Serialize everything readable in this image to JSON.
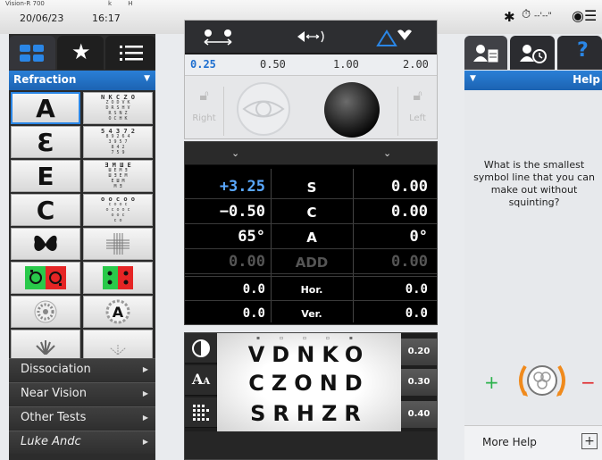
{
  "status_bar": {
    "device_name": "Vision-R 700",
    "ab_marks": "k H",
    "date": "20/06/23",
    "time": "16:17",
    "timer_text": "--'--\"",
    "settings_icon": "gear-icon",
    "timer_icon": "stopwatch-icon",
    "binocular_icon": "eyes-icon"
  },
  "left_panel": {
    "tabs": [
      {
        "icon": "grid-icon",
        "active": true
      },
      {
        "icon": "star-icon",
        "active": false
      },
      {
        "icon": "list-icon",
        "active": false
      }
    ],
    "section_title": "Refraction",
    "tests": [
      {
        "type": "letter",
        "text": "A"
      },
      {
        "type": "chart",
        "lines": [
          "N K C Z O",
          "Z O D V K",
          "D R S H V",
          "R S N Z",
          "O C H K"
        ]
      },
      {
        "type": "letter",
        "text": "Ɛ"
      },
      {
        "type": "chart",
        "lines": [
          "5 4 3 7 2",
          "8 9 2 6 4",
          "3 9 5 7",
          "8 4 2",
          "7 5 9"
        ]
      },
      {
        "type": "letter",
        "text": "E"
      },
      {
        "type": "chart",
        "lines": [
          "Ǝ M Ш E",
          "Ш E M Ǝ",
          "Ш Ǝ E M",
          "E Ш M",
          "M Ǝ"
        ]
      },
      {
        "type": "letter",
        "text": "C"
      },
      {
        "type": "chart",
        "lines": [
          "o o c o o",
          "c o o c",
          "o c o o c",
          "o o c",
          "c o"
        ]
      },
      {
        "type": "icon",
        "text": "butterfly"
      },
      {
        "type": "icon",
        "text": "cross-grid"
      },
      {
        "type": "icon",
        "text": "red-green-duochrome"
      },
      {
        "type": "icon",
        "text": "red-green-dots"
      },
      {
        "type": "icon",
        "text": "astigmatic-dial"
      },
      {
        "type": "icon",
        "text": "circled-A"
      }
    ],
    "menu": [
      {
        "label": "Dissociation"
      },
      {
        "label": "Near Vision"
      },
      {
        "label": "Other Tests"
      },
      {
        "label": "Luke Andc"
      }
    ],
    "colors": {
      "accent": "#1f6fd0"
    }
  },
  "phoropter": {
    "toolbar_icons": [
      "eye-distance-icon",
      "lens-flip-icon",
      "prism-icon"
    ],
    "steps": [
      "0.25",
      "0.50",
      "1.00",
      "2.00"
    ],
    "selected_step": "0.25",
    "right_label": "Right",
    "left_label": "Left",
    "right_eye_state": "open",
    "left_eye_state": "occluded"
  },
  "refraction_values": {
    "rows": [
      {
        "left": "+3.25",
        "label": "S",
        "right": "0.00",
        "highlight": true
      },
      {
        "left": "−0.50",
        "label": "C",
        "right": "0.00"
      },
      {
        "left": "65°",
        "label": "A",
        "right": "0°"
      },
      {
        "left": "0.00",
        "label": "ADD",
        "right": "0.00",
        "dim": true
      },
      {
        "left": "0.0",
        "label": "Hor.",
        "right": "0.0",
        "small": true
      },
      {
        "left": "0.0",
        "label": "Ver.",
        "right": "0.0",
        "small": true
      }
    ]
  },
  "acuity_chart": {
    "side_buttons": [
      "contrast-icon",
      "letter-size-icon",
      "mask-icon"
    ],
    "lines": [
      "VDNKO",
      "CZOND",
      "SRHZR"
    ],
    "acuities": [
      "0.20",
      "0.30",
      "0.40"
    ]
  },
  "help_panel": {
    "tabs": [
      "patient-record-icon",
      "patient-history-icon",
      "help-icon"
    ],
    "header": "Help",
    "text": "What is the smallest symbol line that you can make out without squinting?",
    "plus_sign": "+",
    "minus_sign": "−",
    "more_help": "More Help",
    "expand": "+"
  }
}
